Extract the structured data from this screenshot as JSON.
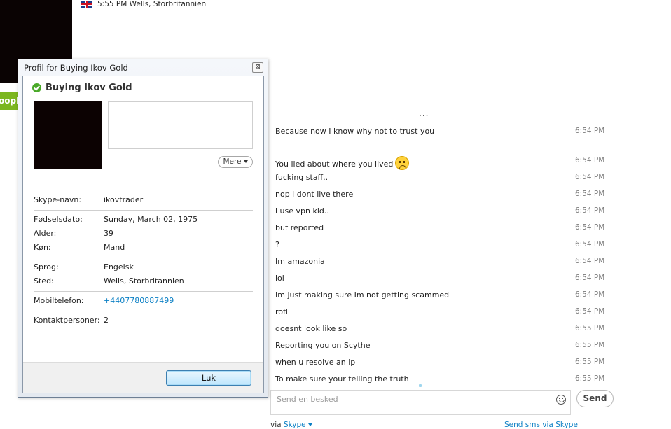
{
  "header": {
    "flag": "uk-flag-icon",
    "local_time_location": "5:55 PM Wells, Storbritannien"
  },
  "sidebar": {
    "green_button_label": "oopl"
  },
  "chat": {
    "ellipsis": "...",
    "messages": [
      {
        "text": "Because now I know why not to trust you",
        "time": "6:54 PM"
      },
      {
        "text": "You lied about where you lived",
        "time": "6:54 PM",
        "emoji": "sad-face-emoji"
      },
      {
        "text": "fucking staff..",
        "time": "6:54 PM"
      },
      {
        "text": "nop i dont live there",
        "time": "6:54 PM"
      },
      {
        "text": "i use vpn kid..",
        "time": "6:54 PM"
      },
      {
        "text": "but reported",
        "time": "6:54 PM"
      },
      {
        "text": "?",
        "time": "6:54 PM"
      },
      {
        "text": "Im amazonia",
        "time": "6:54 PM"
      },
      {
        "text": "lol",
        "time": "6:54 PM"
      },
      {
        "text": "Im just making sure Im not getting scammed",
        "time": "6:54 PM"
      },
      {
        "text": "rofl",
        "time": "6:54 PM"
      },
      {
        "text": "doesnt look like so",
        "time": "6:55 PM"
      },
      {
        "text": "Reporting you on Scythe",
        "time": "6:55 PM"
      },
      {
        "text": "when u resolve an ip",
        "time": "6:55 PM"
      },
      {
        "text": "To make sure your telling the truth",
        "time": "6:55 PM"
      }
    ]
  },
  "compose": {
    "placeholder": "Send en besked",
    "send_label": "Send",
    "via_prefix": "via",
    "via_link": "Skype",
    "sms_link": "Send sms via Skype"
  },
  "profile_dialog": {
    "title": "Profil for Buying Ikov Gold",
    "close_symbol": "⊠",
    "name": "Buying Ikov Gold",
    "more_label": "Mere",
    "groups": [
      [
        {
          "label": "Skype-navn:",
          "value": "ikovtrader"
        }
      ],
      [
        {
          "label": "Fødselsdato:",
          "value": "Sunday, March 02, 1975"
        },
        {
          "label": "Alder:",
          "value": "39"
        },
        {
          "label": "Køn:",
          "value": "Mand"
        }
      ],
      [
        {
          "label": "Sprog:",
          "value": "Engelsk"
        },
        {
          "label": "Sted:",
          "value": "Wells, Storbritannien"
        }
      ],
      [
        {
          "label": "Mobiltelefon:",
          "value": "+4407780887499",
          "link": true
        }
      ],
      [
        {
          "label": "Kontaktpersoner:",
          "value": "2"
        }
      ]
    ],
    "close_button_label": "Luk"
  },
  "colors": {
    "link": "#0a7fc4",
    "status_online": "#4aa929",
    "green_button": "#7bb61e"
  }
}
